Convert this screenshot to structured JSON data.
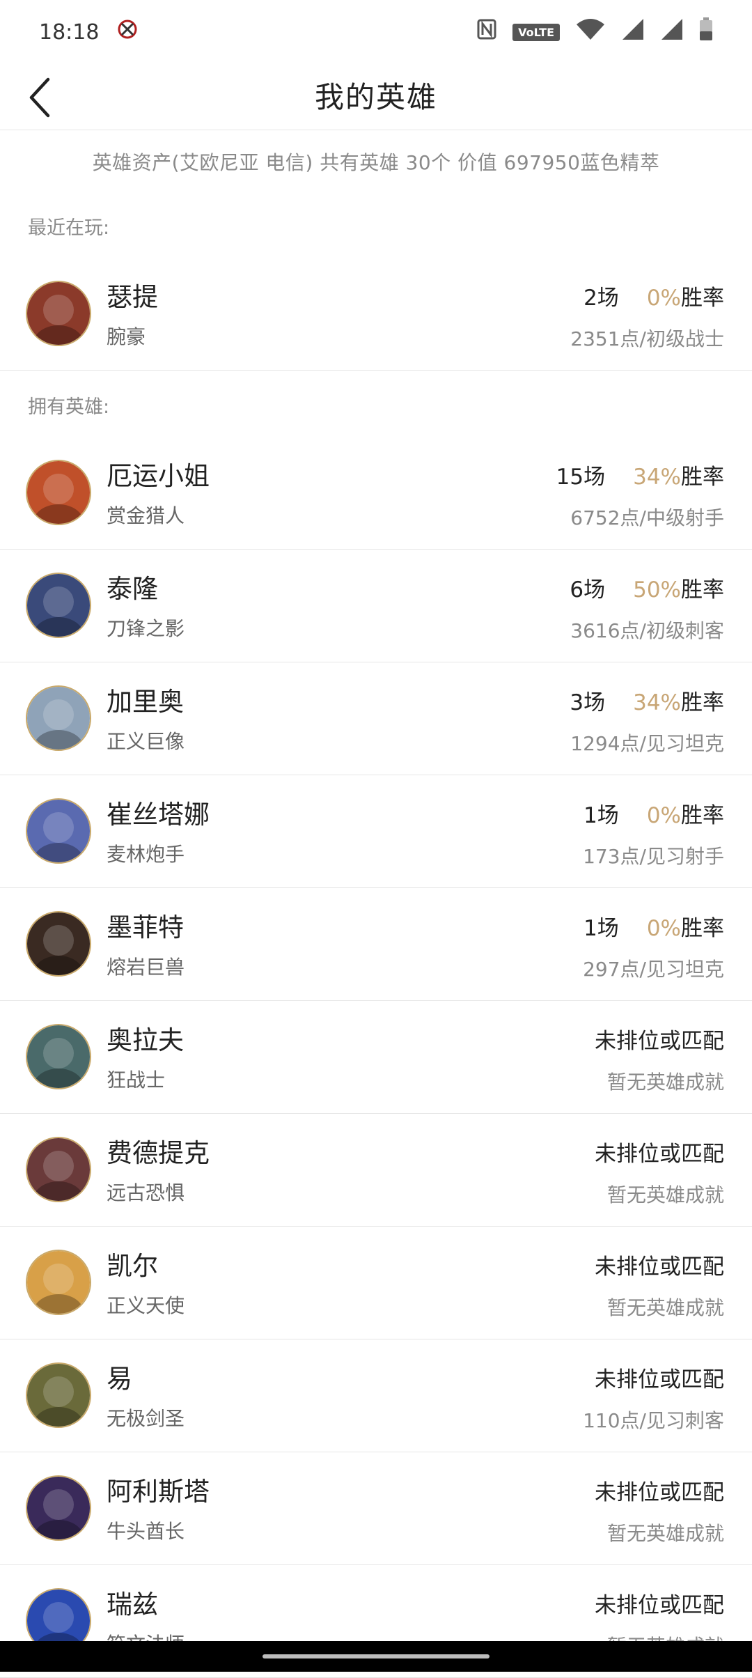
{
  "status_bar": {
    "time": "18:18",
    "volte": "VoLTE"
  },
  "header": {
    "title": "我的英雄"
  },
  "summary": "英雄资产(艾欧尼亚 电信) 共有英雄 30个 价值 697950蓝色精萃",
  "recent": {
    "label": "最近在玩:",
    "heroes": [
      {
        "name": "瑟提",
        "title": "腕豪",
        "games": "2场",
        "winrate": "0%",
        "winrate_label": "胜率",
        "points": "2351点/初级战士",
        "avatar_color": "#8b3a2a"
      }
    ]
  },
  "owned": {
    "label": "拥有英雄:",
    "heroes": [
      {
        "name": "厄运小姐",
        "title": "赏金猎人",
        "games": "15场",
        "winrate": "34%",
        "winrate_label": "胜率",
        "points": "6752点/中级射手",
        "avatar_color": "#c0502a"
      },
      {
        "name": "泰隆",
        "title": "刀锋之影",
        "games": "6场",
        "winrate": "50%",
        "winrate_label": "胜率",
        "points": "3616点/初级刺客",
        "avatar_color": "#3a4a7a"
      },
      {
        "name": "加里奥",
        "title": "正义巨像",
        "games": "3场",
        "winrate": "34%",
        "winrate_label": "胜率",
        "points": "1294点/见习坦克",
        "avatar_color": "#8fa3b8"
      },
      {
        "name": "崔丝塔娜",
        "title": "麦林炮手",
        "games": "1场",
        "winrate": "0%",
        "winrate_label": "胜率",
        "points": "173点/见习射手",
        "avatar_color": "#5a6ab0"
      },
      {
        "name": "墨菲特",
        "title": "熔岩巨兽",
        "games": "1场",
        "winrate": "0%",
        "winrate_label": "胜率",
        "points": "297点/见习坦克",
        "avatar_color": "#3a2a22"
      },
      {
        "name": "奥拉夫",
        "title": "狂战士",
        "status": "未排位或匹配",
        "points": "暂无英雄成就",
        "avatar_color": "#4a6a6a"
      },
      {
        "name": "费德提克",
        "title": "远古恐惧",
        "status": "未排位或匹配",
        "points": "暂无英雄成就",
        "avatar_color": "#6a3a3a"
      },
      {
        "name": "凯尔",
        "title": "正义天使",
        "status": "未排位或匹配",
        "points": "暂无英雄成就",
        "avatar_color": "#d8a048"
      },
      {
        "name": "易",
        "title": "无极剑圣",
        "status": "未排位或匹配",
        "points": "110点/见习刺客",
        "avatar_color": "#6a6a3a"
      },
      {
        "name": "阿利斯塔",
        "title": "牛头酋长",
        "status": "未排位或匹配",
        "points": "暂无英雄成就",
        "avatar_color": "#3a2a5a"
      },
      {
        "name": "瑞兹",
        "title": "符文法师",
        "status": "未排位或匹配",
        "points": "暂无英雄成就",
        "avatar_color": "#2a4ab0"
      }
    ]
  }
}
